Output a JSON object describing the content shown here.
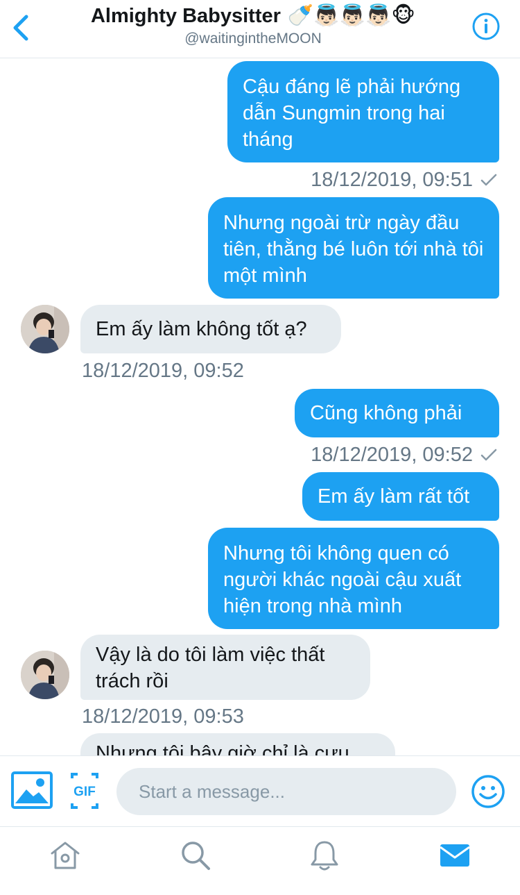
{
  "header": {
    "title": "Almighty Babysitter",
    "title_emojis": "🍼👼🏻👼🏻👼🏻🐵",
    "handle": "@waitingintheMOON",
    "back_icon": "chevron-left-icon",
    "info_icon": "info-icon"
  },
  "messages": [
    {
      "direction": "out",
      "text": "Cậu đáng lẽ phải hướng dẫn Sungmin trong hai tháng",
      "timestamp": "18/12/2019, 09:51",
      "read": true
    },
    {
      "direction": "out",
      "text": "Nhưng ngoài trừ ngày đầu tiên, thằng bé luôn tới nhà tôi một mình",
      "timestamp": "",
      "read": false
    },
    {
      "direction": "in",
      "text": "Em ấy làm không tốt ạ?",
      "timestamp": "18/12/2019, 09:52"
    },
    {
      "direction": "out",
      "text": "Cũng không phải",
      "timestamp": "18/12/2019, 09:52",
      "read": true
    },
    {
      "direction": "out",
      "text": "Em ấy làm rất tốt",
      "timestamp": "",
      "read": false
    },
    {
      "direction": "out",
      "text": "Nhưng tôi không quen có người khác ngoài cậu xuất hiện trong nhà mình",
      "timestamp": "",
      "read": false
    },
    {
      "direction": "in",
      "text": "Vậy là do tôi làm việc thất trách rồi",
      "timestamp": "18/12/2019, 09:53"
    },
    {
      "direction": "in",
      "text": "Nhưng tôi bây giờ chỉ là cựu",
      "timestamp": ""
    }
  ],
  "composer": {
    "placeholder": "Start a message...",
    "value": "",
    "gif_label": "GIF",
    "media_icon": "image-icon",
    "emoji_icon": "smiley-icon"
  },
  "tabs": [
    {
      "name": "home",
      "icon": "home-icon",
      "active": false
    },
    {
      "name": "search",
      "icon": "search-icon",
      "active": false
    },
    {
      "name": "notifications",
      "icon": "bell-icon",
      "active": false
    },
    {
      "name": "messages",
      "icon": "mail-icon",
      "active": true
    }
  ],
  "colors": {
    "accent": "#1da1f2",
    "incoming_bubble": "#e6ecf0",
    "timestamp": "#657786",
    "inactive_icon": "#8899a6"
  }
}
